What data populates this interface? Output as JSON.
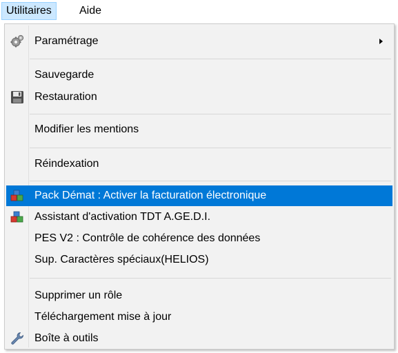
{
  "menubar": {
    "items": [
      {
        "label": "Utilitaires"
      },
      {
        "label": "Aide"
      }
    ]
  },
  "dropdown": {
    "items": [
      {
        "label": "Paramétrage",
        "icon": "gears-icon",
        "has_submenu": true
      },
      {
        "label": "Sauvegarde"
      },
      {
        "label": "Restauration",
        "icon": "floppy-disk-icon"
      },
      {
        "label": "Modifier les mentions"
      },
      {
        "label": "Réindexation"
      },
      {
        "label": "Pack Démat : Activer la facturation électronique",
        "icon": "colored-blocks-icon",
        "highlighted": true
      },
      {
        "label": "Assistant d'activation TDT A.GE.D.I.",
        "icon": "colored-blocks-icon"
      },
      {
        "label": "PES V2 : Contrôle de cohérence des données"
      },
      {
        "label": "Sup. Caractères spéciaux(HELIOS)"
      },
      {
        "label": "Supprimer un rôle"
      },
      {
        "label": "Téléchargement mise à jour"
      },
      {
        "label": "Boîte à outils",
        "icon": "wrench-icon"
      }
    ]
  },
  "colors": {
    "highlight": "#0078d7",
    "menubar_active": "#cce8ff",
    "menu_background": "#f2f2f2"
  }
}
